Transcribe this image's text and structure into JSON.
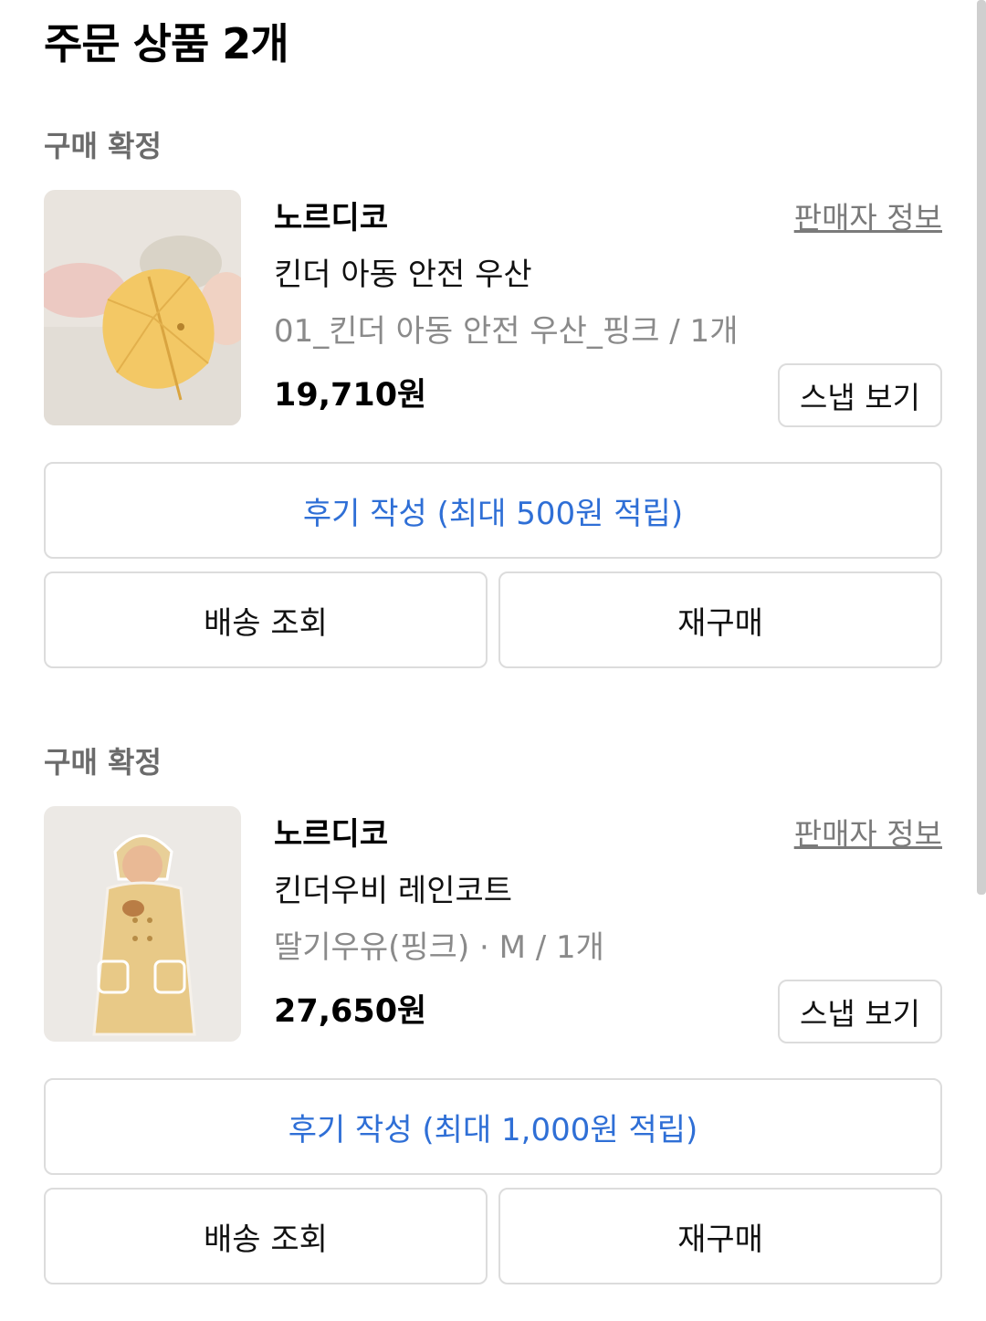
{
  "page": {
    "title": "주문 상품 2개"
  },
  "orders": [
    {
      "status": "구매 확정",
      "brand": "노르디코",
      "seller_info": "판매자 정보",
      "product_name": "킨더 아동 안전 우산",
      "option": "01_킨더 아동 안전 우산_핑크 / 1개",
      "price": "19,710원",
      "snap_label": "스냅 보기",
      "review_label": "후기 작성 (최대 500원 적립)",
      "delivery_label": "배송 조회",
      "rebuy_label": "재구매",
      "image_icon": "umbrella-product-image"
    },
    {
      "status": "구매 확정",
      "brand": "노르디코",
      "seller_info": "판매자 정보",
      "product_name": "킨더우비 레인코트",
      "option": "딸기우유(핑크) · M / 1개",
      "price": "27,650원",
      "snap_label": "스냅 보기",
      "review_label": "후기 작성 (최대 1,000원 적립)",
      "delivery_label": "배송 조회",
      "rebuy_label": "재구매",
      "image_icon": "raincoat-product-image"
    }
  ],
  "colors": {
    "accent_blue": "#2f6fd6",
    "status_gray": "#6b6b6b",
    "border": "#dcdcdc"
  }
}
